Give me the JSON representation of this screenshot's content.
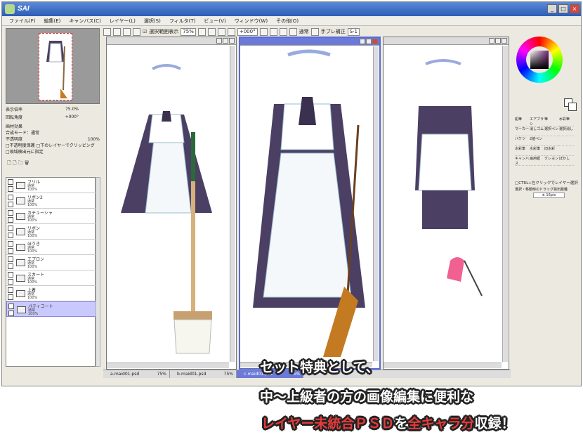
{
  "window": {
    "title": "SAI"
  },
  "menu": [
    "ファイル(F)",
    "編集(E)",
    "キャンバス(C)",
    "レイヤー(L)",
    "選択(S)",
    "フィルタ(T)",
    "ビュー(V)",
    "ウィンドウ(W)",
    "その他(O)"
  ],
  "toolbar": {
    "checkbox_label": "選択範囲表示",
    "zoom": "75%",
    "rotate": "+000°",
    "blend": "通常",
    "stabilizer_label": "手ブレ補正",
    "stabilizer": "S-1"
  },
  "nav": {
    "zoom_label": "表示倍率",
    "zoom_value": "75.0%",
    "rotate_label": "回転角度",
    "rotate_value": "+000°"
  },
  "layer_props": {
    "effect": "画材効果",
    "blend_label": "合成モード",
    "blend_value": "通常",
    "opacity_label": "不透明度",
    "opacity_value": "100%",
    "opt1": "不透明度保護",
    "opt2": "下のレイヤーでクリッピング",
    "opt3": "領域検出元に指定"
  },
  "layers": [
    {
      "name": "フリル",
      "mode": "通常",
      "opacity": "100%"
    },
    {
      "name": "リボン2",
      "mode": "通常",
      "opacity": "100%"
    },
    {
      "name": "カチューシャ",
      "mode": "通常",
      "opacity": "100%"
    },
    {
      "name": "リボン",
      "mode": "通常",
      "opacity": "100%"
    },
    {
      "name": "ほうき",
      "mode": "通常",
      "opacity": "100%"
    },
    {
      "name": "エプロン",
      "mode": "通常",
      "opacity": "100%"
    },
    {
      "name": "スカート",
      "mode": "通常",
      "opacity": "100%"
    },
    {
      "name": "上着",
      "mode": "通常",
      "opacity": "100%"
    },
    {
      "name": "パティコート",
      "mode": "通常",
      "opacity": "100%"
    }
  ],
  "tabs": [
    {
      "name": "a-maid01.psd",
      "zoom": "75%"
    },
    {
      "name": "b-maid01.psd",
      "zoom": "75%"
    },
    {
      "name": "c-maid01.psd",
      "zoom": "75%"
    }
  ],
  "tools": [
    "鉛筆",
    "エアブラシ",
    "筆",
    "水彩筆",
    "マーカー",
    "消しゴム",
    "選択ペン",
    "選択消し",
    "バケツ",
    "2値ペン",
    "",
    "",
    "水彩筆",
    "水彩筆",
    "旧水彩",
    "",
    "キャンバス",
    "画用紙",
    "クレヨン",
    "ぼかし"
  ],
  "right_panel": {
    "ctrl_label": "CTRL+左クリックでレイヤー選択",
    "drag_label": "選択・移動時のドラッグ検出距離",
    "drag_value": "± 16pix"
  },
  "caption": {
    "line1": "セット特典として、",
    "line2": "中～上級者の方の画像編集に便利な",
    "line3_red1": "レイヤー未統合ＰＳＤ",
    "line3_white1": "を",
    "line3_red2": "全キャラ分",
    "line3_white2": "収録！"
  },
  "colors": {
    "titlebar": "#2c5cb8",
    "active_tab": "#6b7ad8",
    "caption_red": "#e33b3b"
  }
}
